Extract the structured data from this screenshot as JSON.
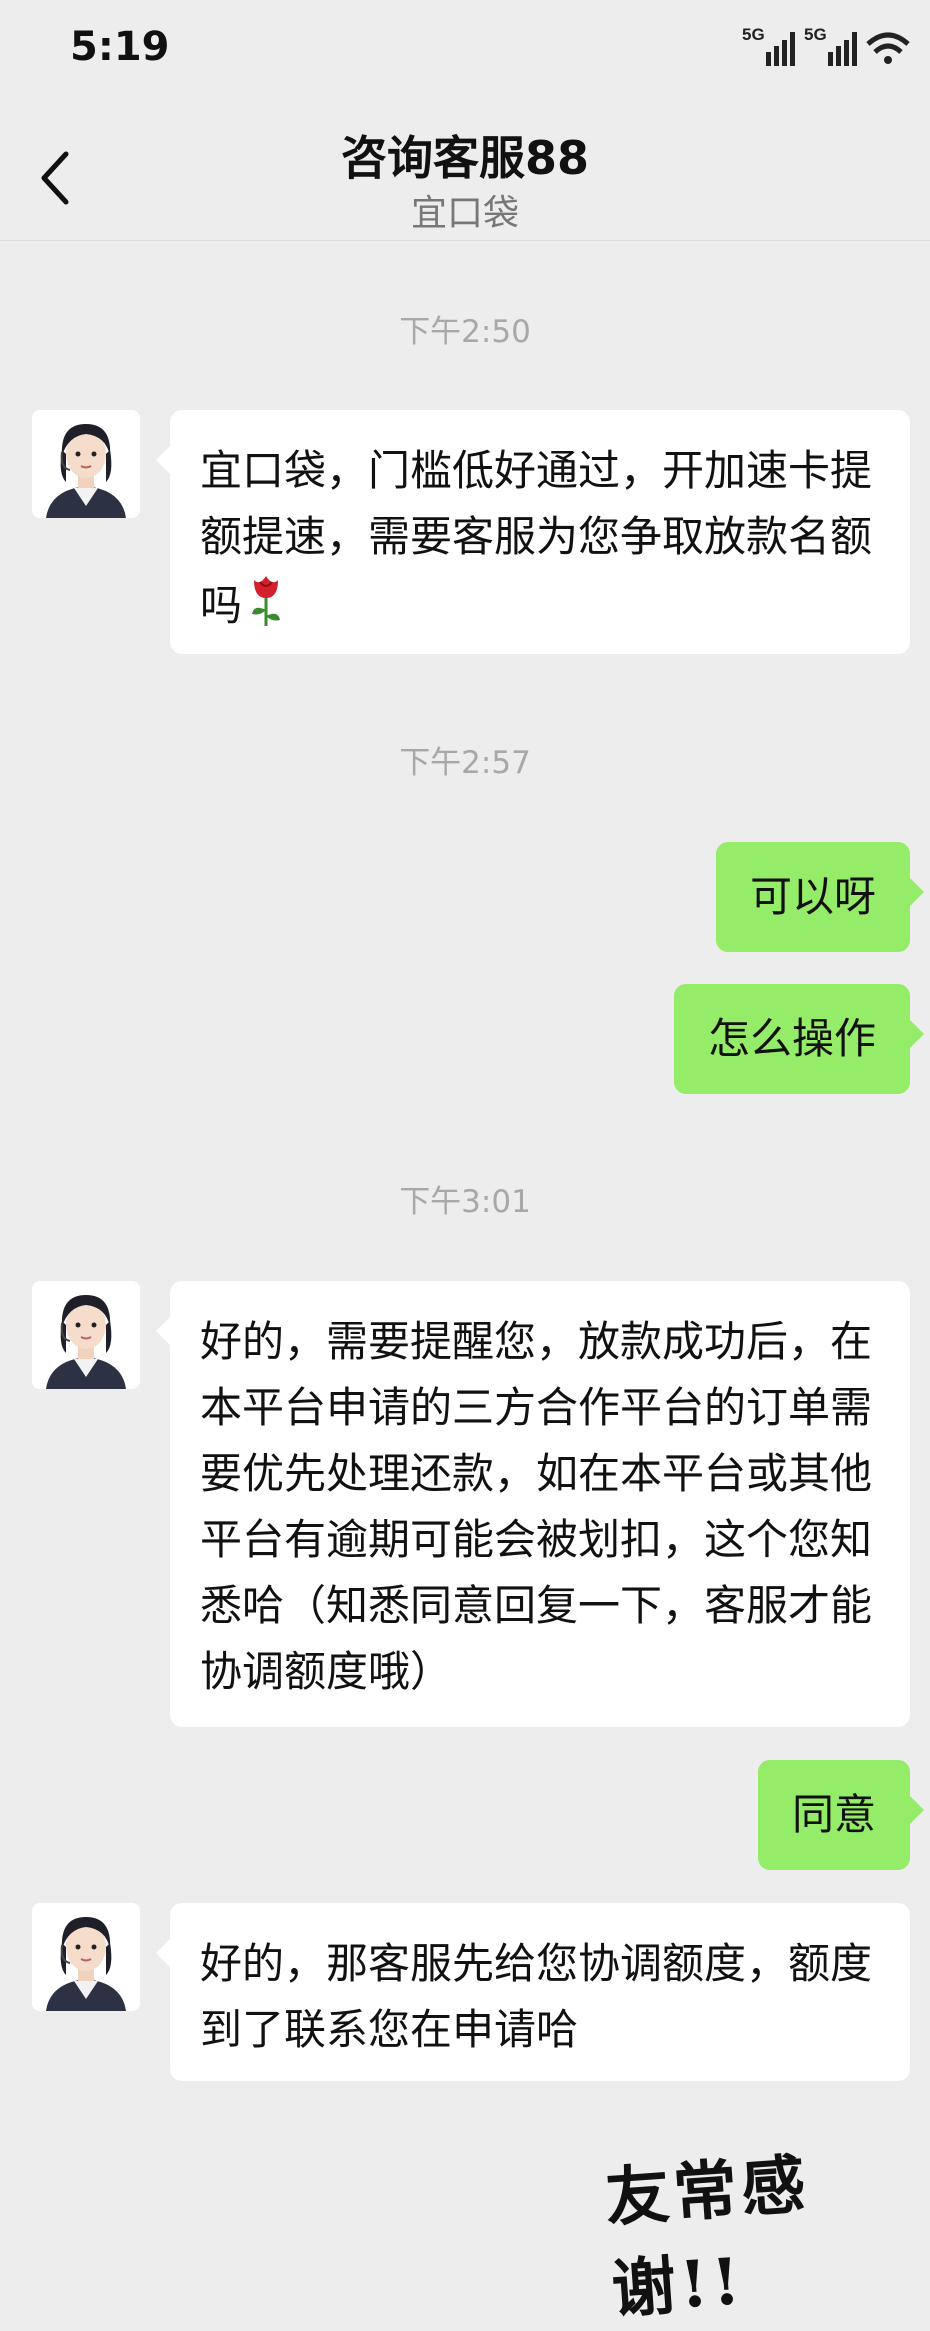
{
  "status_bar": {
    "time": "5:19",
    "network_1": "5G",
    "network_2": "5G"
  },
  "nav": {
    "title": "咨询客服88",
    "subtitle": "宜口袋",
    "back_icon": "chevron-left-icon"
  },
  "timestamps": [
    "下午2:50",
    "下午2:57",
    "下午3:01"
  ],
  "messages": [
    {
      "side": "left",
      "text": "宜口袋，门槛低好通过，开加速卡提额提速，需要客服为您争取放款名额吗",
      "emoji": "rose"
    },
    {
      "side": "right",
      "text": "可以呀"
    },
    {
      "side": "right",
      "text": "怎么操作"
    },
    {
      "side": "left",
      "text": "好的，需要提醒您，放款成功后，在本平台申请的三方合作平台的订单需要优先处理还款，如在本平台或其他平台有逾期可能会被划扣，这个您知悉哈（知悉同意回复一下，客服才能协调额度哦）"
    },
    {
      "side": "right",
      "text": "同意"
    },
    {
      "side": "left",
      "text": "好的，那客服先给您协调额度，额度到了联系您在申请哈"
    }
  ],
  "overlay_text": "友常感谢!!",
  "colors": {
    "background": "#ededed",
    "bubble_self": "#95ec69",
    "bubble_other": "#ffffff",
    "timestamp": "#a8a8a8"
  }
}
